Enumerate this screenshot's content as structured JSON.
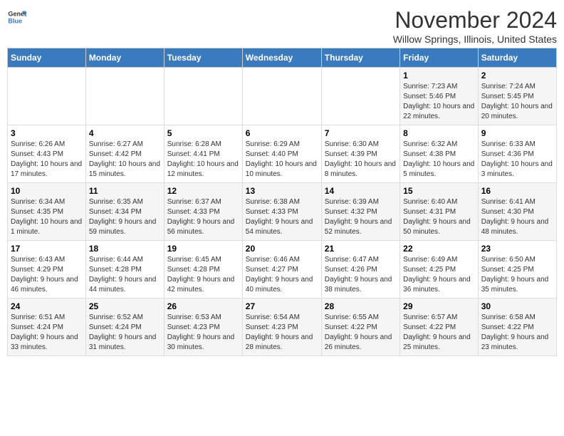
{
  "logo": {
    "line1": "General",
    "line2": "Blue"
  },
  "title": "November 2024",
  "subtitle": "Willow Springs, Illinois, United States",
  "days_of_week": [
    "Sunday",
    "Monday",
    "Tuesday",
    "Wednesday",
    "Thursday",
    "Friday",
    "Saturday"
  ],
  "weeks": [
    [
      {
        "day": "",
        "info": ""
      },
      {
        "day": "",
        "info": ""
      },
      {
        "day": "",
        "info": ""
      },
      {
        "day": "",
        "info": ""
      },
      {
        "day": "",
        "info": ""
      },
      {
        "day": "1",
        "info": "Sunrise: 7:23 AM\nSunset: 5:46 PM\nDaylight: 10 hours and 22 minutes."
      },
      {
        "day": "2",
        "info": "Sunrise: 7:24 AM\nSunset: 5:45 PM\nDaylight: 10 hours and 20 minutes."
      }
    ],
    [
      {
        "day": "3",
        "info": "Sunrise: 6:26 AM\nSunset: 4:43 PM\nDaylight: 10 hours and 17 minutes."
      },
      {
        "day": "4",
        "info": "Sunrise: 6:27 AM\nSunset: 4:42 PM\nDaylight: 10 hours and 15 minutes."
      },
      {
        "day": "5",
        "info": "Sunrise: 6:28 AM\nSunset: 4:41 PM\nDaylight: 10 hours and 12 minutes."
      },
      {
        "day": "6",
        "info": "Sunrise: 6:29 AM\nSunset: 4:40 PM\nDaylight: 10 hours and 10 minutes."
      },
      {
        "day": "7",
        "info": "Sunrise: 6:30 AM\nSunset: 4:39 PM\nDaylight: 10 hours and 8 minutes."
      },
      {
        "day": "8",
        "info": "Sunrise: 6:32 AM\nSunset: 4:38 PM\nDaylight: 10 hours and 5 minutes."
      },
      {
        "day": "9",
        "info": "Sunrise: 6:33 AM\nSunset: 4:36 PM\nDaylight: 10 hours and 3 minutes."
      }
    ],
    [
      {
        "day": "10",
        "info": "Sunrise: 6:34 AM\nSunset: 4:35 PM\nDaylight: 10 hours and 1 minute."
      },
      {
        "day": "11",
        "info": "Sunrise: 6:35 AM\nSunset: 4:34 PM\nDaylight: 9 hours and 59 minutes."
      },
      {
        "day": "12",
        "info": "Sunrise: 6:37 AM\nSunset: 4:33 PM\nDaylight: 9 hours and 56 minutes."
      },
      {
        "day": "13",
        "info": "Sunrise: 6:38 AM\nSunset: 4:33 PM\nDaylight: 9 hours and 54 minutes."
      },
      {
        "day": "14",
        "info": "Sunrise: 6:39 AM\nSunset: 4:32 PM\nDaylight: 9 hours and 52 minutes."
      },
      {
        "day": "15",
        "info": "Sunrise: 6:40 AM\nSunset: 4:31 PM\nDaylight: 9 hours and 50 minutes."
      },
      {
        "day": "16",
        "info": "Sunrise: 6:41 AM\nSunset: 4:30 PM\nDaylight: 9 hours and 48 minutes."
      }
    ],
    [
      {
        "day": "17",
        "info": "Sunrise: 6:43 AM\nSunset: 4:29 PM\nDaylight: 9 hours and 46 minutes."
      },
      {
        "day": "18",
        "info": "Sunrise: 6:44 AM\nSunset: 4:28 PM\nDaylight: 9 hours and 44 minutes."
      },
      {
        "day": "19",
        "info": "Sunrise: 6:45 AM\nSunset: 4:28 PM\nDaylight: 9 hours and 42 minutes."
      },
      {
        "day": "20",
        "info": "Sunrise: 6:46 AM\nSunset: 4:27 PM\nDaylight: 9 hours and 40 minutes."
      },
      {
        "day": "21",
        "info": "Sunrise: 6:47 AM\nSunset: 4:26 PM\nDaylight: 9 hours and 38 minutes."
      },
      {
        "day": "22",
        "info": "Sunrise: 6:49 AM\nSunset: 4:25 PM\nDaylight: 9 hours and 36 minutes."
      },
      {
        "day": "23",
        "info": "Sunrise: 6:50 AM\nSunset: 4:25 PM\nDaylight: 9 hours and 35 minutes."
      }
    ],
    [
      {
        "day": "24",
        "info": "Sunrise: 6:51 AM\nSunset: 4:24 PM\nDaylight: 9 hours and 33 minutes."
      },
      {
        "day": "25",
        "info": "Sunrise: 6:52 AM\nSunset: 4:24 PM\nDaylight: 9 hours and 31 minutes."
      },
      {
        "day": "26",
        "info": "Sunrise: 6:53 AM\nSunset: 4:23 PM\nDaylight: 9 hours and 30 minutes."
      },
      {
        "day": "27",
        "info": "Sunrise: 6:54 AM\nSunset: 4:23 PM\nDaylight: 9 hours and 28 minutes."
      },
      {
        "day": "28",
        "info": "Sunrise: 6:55 AM\nSunset: 4:22 PM\nDaylight: 9 hours and 26 minutes."
      },
      {
        "day": "29",
        "info": "Sunrise: 6:57 AM\nSunset: 4:22 PM\nDaylight: 9 hours and 25 minutes."
      },
      {
        "day": "30",
        "info": "Sunrise: 6:58 AM\nSunset: 4:22 PM\nDaylight: 9 hours and 23 minutes."
      }
    ]
  ]
}
